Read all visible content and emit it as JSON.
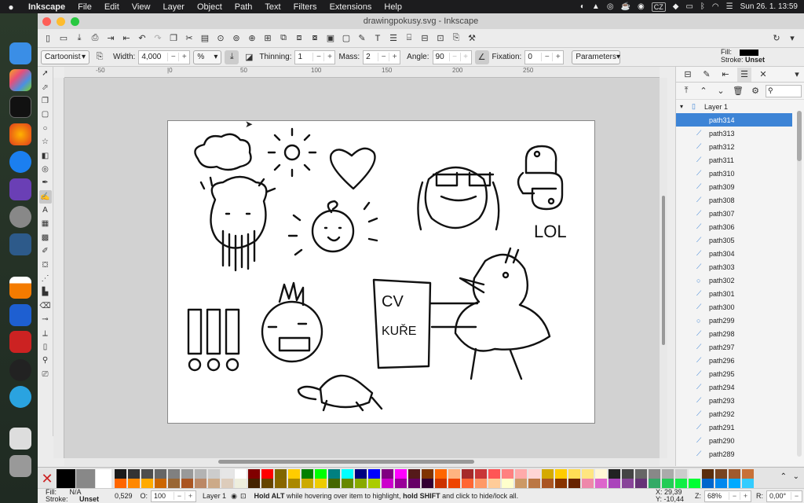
{
  "menubar": {
    "app_name": "Inkscape",
    "items": [
      "File",
      "Edit",
      "View",
      "Layer",
      "Object",
      "Path",
      "Text",
      "Filters",
      "Extensions",
      "Help"
    ],
    "status_right": {
      "input_source": "CZ",
      "clock": "Sun 26. 1.  13:59"
    }
  },
  "window": {
    "title": "drawingpokusy.svg - Inkscape"
  },
  "tool_controls": {
    "preset": "Cartoonist",
    "width_label": "Width:",
    "width_value": "4,000",
    "unit": "%",
    "thinning_label": "Thinning:",
    "thinning_value": "1",
    "mass_label": "Mass:",
    "mass_value": "2",
    "angle_label": "Angle:",
    "angle_value": "90",
    "fixation_label": "Fixation:",
    "fixation_value": "0",
    "parameters_label": "Parameters"
  },
  "style_indicator": {
    "fill_label": "Fill:",
    "stroke_label": "Stroke:",
    "stroke_value": "Unset"
  },
  "ruler": {
    "ticks": [
      "-50",
      "|0",
      "50",
      "100",
      "150",
      "200",
      "250"
    ]
  },
  "drawing_text": {
    "cv": "CV",
    "kure": "KUŘE",
    "lol": "LOL"
  },
  "layers_panel": {
    "layer_name": "Layer 1",
    "paths": [
      "path314",
      "path313",
      "path312",
      "path311",
      "path310",
      "path309",
      "path308",
      "path307",
      "path306",
      "path305",
      "path304",
      "path303",
      "path302",
      "path301",
      "path300",
      "path299",
      "path298",
      "path297",
      "path296",
      "path295",
      "path294",
      "path293",
      "path292",
      "path291",
      "path290",
      "path289"
    ],
    "circle_items": [
      "path302",
      "path299"
    ],
    "selected": "path314"
  },
  "statusbar": {
    "fill_label": "Fill:",
    "fill_value": "N/A",
    "stroke_label": "Stroke:",
    "stroke_value": "Unset",
    "stroke_width": "0,529",
    "opacity_label": "O:",
    "opacity_value": "100",
    "layer": "Layer 1",
    "hint_bold1": "Hold ALT",
    "hint1": " while hovering over item to highlight, ",
    "hint_bold2": "hold SHIFT",
    "hint2": " and click to hide/lock all.",
    "x_label": "X:",
    "x_value": "29,39",
    "y_label": "Y:",
    "y_value": "-10,44",
    "zoom_label": "Z:",
    "zoom_value": "68%",
    "rotation_label": "R:",
    "rotation_value": "0,00°"
  },
  "colors": {
    "accent": "#3d84d6",
    "selected_row": "#3d84d6"
  }
}
